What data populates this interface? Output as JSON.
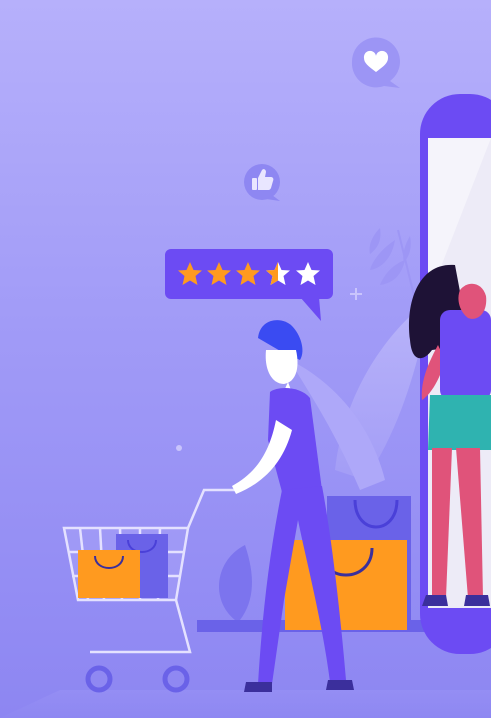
{
  "illustration": {
    "subject": "online shopping",
    "rating": {
      "value": 3.5,
      "max": 5
    },
    "icons": [
      "heart-icon",
      "thumbs-up-icon",
      "star-icon",
      "shopping-cart-icon",
      "shopping-bag-icon",
      "plus-icon"
    ],
    "colors": {
      "background_top": "#B6B0FB",
      "background_bottom": "#8D86F2",
      "accent_purple": "#6C4BF3",
      "star_orange": "#FF9A1F",
      "bag_orange": "#FF9A1F",
      "skin_pink": "#F3A6B6",
      "woman_legs": "#E0537A",
      "woman_skirt": "#2FB3B0",
      "hair_dark": "#1E1236",
      "hair_blue": "#3A4BF2"
    }
  }
}
